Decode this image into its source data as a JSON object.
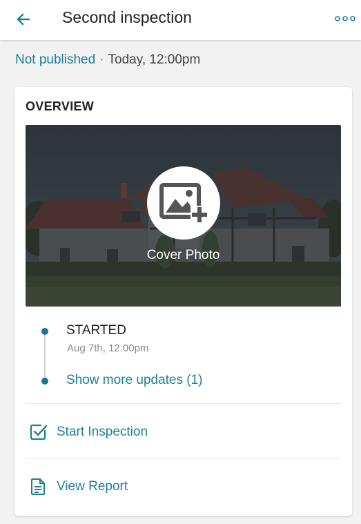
{
  "header": {
    "title": "Second inspection",
    "back_icon": "arrow-left-icon",
    "menu_icon": "more-horizontal-icon"
  },
  "status": {
    "published": "Not published",
    "separator": "·",
    "time": "Today, 12:00pm"
  },
  "overview": {
    "heading": "OVERVIEW",
    "cover_label": "Cover Photo",
    "cover_icon": "add-photo-icon"
  },
  "timeline": {
    "items": [
      {
        "status": "STARTED",
        "date": "Aug 7th, 12:00pm"
      }
    ],
    "more_label": "Show more updates (1)"
  },
  "actions": {
    "start_label": "Start Inspection",
    "start_icon": "checkbox-edit-icon",
    "report_label": "View Report",
    "report_icon": "document-icon"
  },
  "colors": {
    "accent": "#1a7f99",
    "timeline_dot": "#15788f",
    "background": "#f2f2f2"
  }
}
